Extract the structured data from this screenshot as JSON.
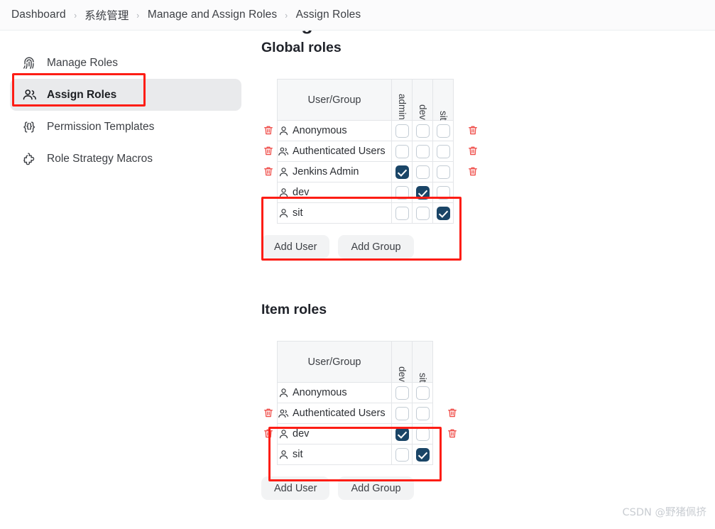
{
  "breadcrumb": {
    "items": [
      {
        "label": "Dashboard"
      },
      {
        "label": "系统管理"
      },
      {
        "label": "Manage and Assign Roles"
      },
      {
        "label": "Assign Roles"
      }
    ],
    "separator": "›"
  },
  "page": {
    "title": "Assign Roles"
  },
  "sidebar": {
    "items": [
      {
        "label": "Manage Roles",
        "icon": "fingerprint-icon",
        "active": false
      },
      {
        "label": "Assign Roles",
        "icon": "people-icon",
        "active": true
      },
      {
        "label": "Permission Templates",
        "icon": "curly-braces-icon",
        "active": false
      },
      {
        "label": "Role Strategy Macros",
        "icon": "puzzle-icon",
        "active": false
      }
    ]
  },
  "global_roles": {
    "heading": "Global roles",
    "columns": [
      "User/Group",
      "admin",
      "dev",
      "sit"
    ],
    "rows": [
      {
        "name": "Anonymous",
        "icon": "user-icon",
        "deletable": false,
        "checks": [
          false,
          false,
          false
        ]
      },
      {
        "name": "Authenticated Users",
        "icon": "users-icon",
        "deletable": false,
        "checks": [
          false,
          false,
          false
        ]
      },
      {
        "name": "Jenkins Admin",
        "icon": "user-icon",
        "deletable": true,
        "checks": [
          true,
          false,
          false
        ]
      },
      {
        "name": "dev",
        "icon": "user-icon",
        "deletable": true,
        "checks": [
          false,
          true,
          false
        ]
      },
      {
        "name": "sit",
        "icon": "user-icon",
        "deletable": true,
        "checks": [
          false,
          false,
          true
        ]
      }
    ],
    "add_user_label": "Add User",
    "add_group_label": "Add Group"
  },
  "item_roles": {
    "heading": "Item roles",
    "columns": [
      "User/Group",
      "dev",
      "sit"
    ],
    "rows": [
      {
        "name": "Anonymous",
        "icon": "user-icon",
        "deletable": false,
        "checks": [
          false,
          false
        ]
      },
      {
        "name": "Authenticated Users",
        "icon": "users-icon",
        "deletable": false,
        "checks": [
          false,
          false
        ]
      },
      {
        "name": "dev",
        "icon": "user-icon",
        "deletable": true,
        "checks": [
          true,
          false
        ]
      },
      {
        "name": "sit",
        "icon": "user-icon",
        "deletable": true,
        "checks": [
          false,
          true
        ]
      }
    ],
    "add_user_label": "Add User",
    "add_group_label": "Add Group"
  },
  "watermark": {
    "text": "CSDN @野猪佩挤"
  },
  "colors": {
    "annotation": "#fd1d15",
    "checkbox_checked": "#1a4567",
    "trash": "#ef4a46",
    "sidebar_active_bg": "#e9eaec"
  }
}
